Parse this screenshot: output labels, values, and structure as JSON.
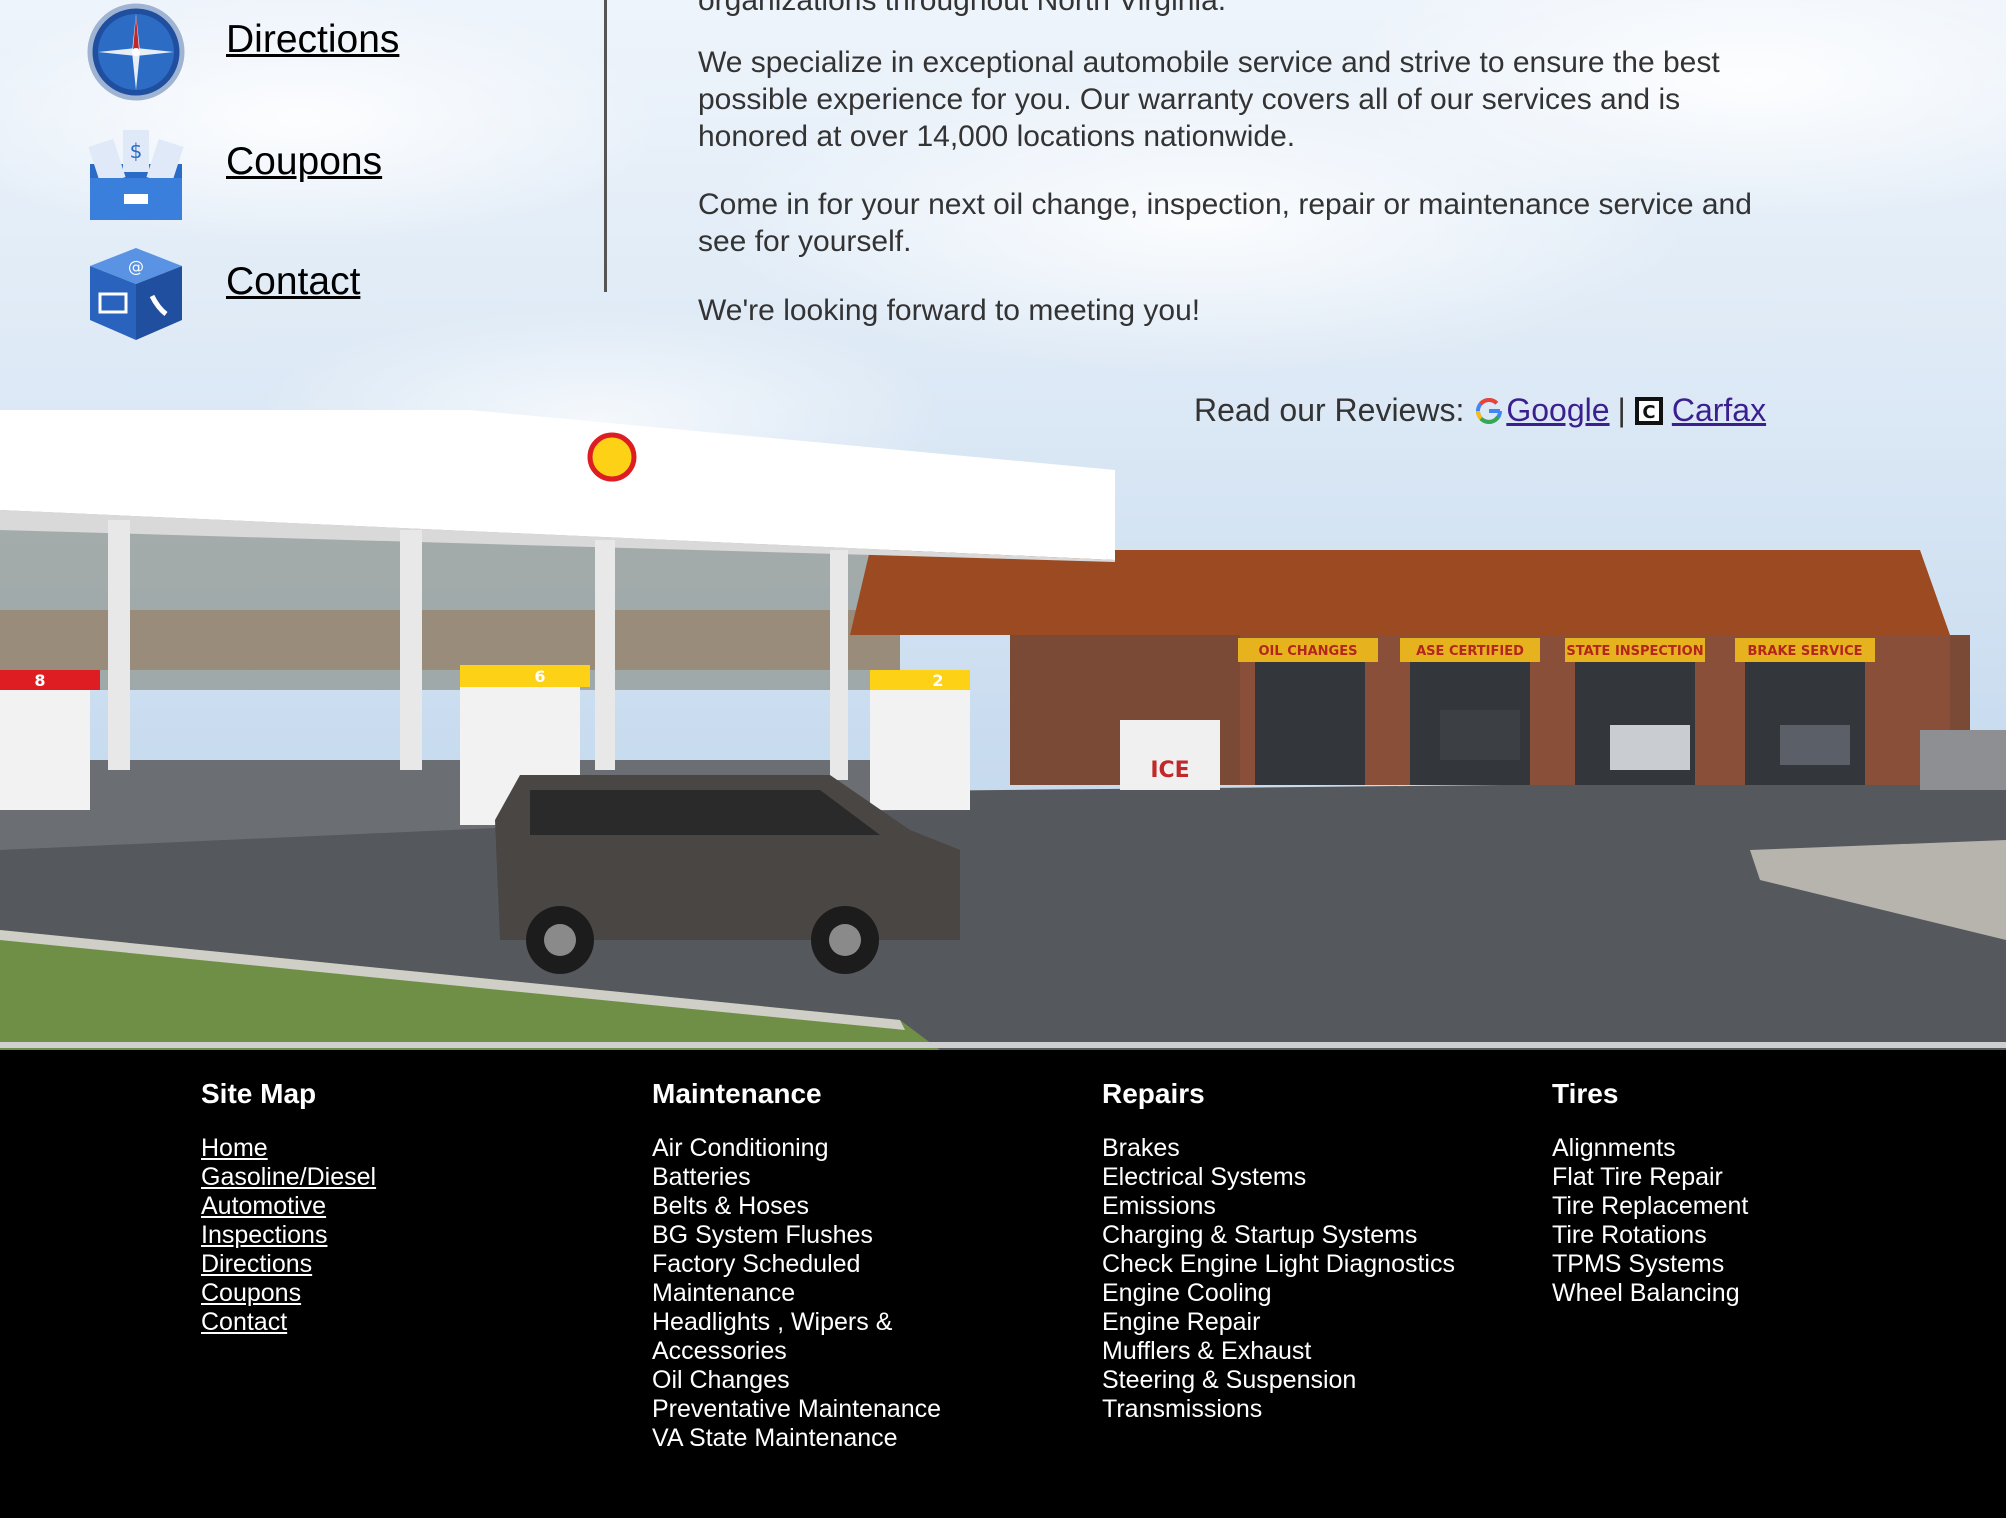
{
  "nav": {
    "directions": {
      "label": "Directions",
      "icon": "compass-icon"
    },
    "coupons": {
      "label": "Coupons",
      "icon": "coupons-icon"
    },
    "contact": {
      "label": "Contact",
      "icon": "contact-cube-icon"
    }
  },
  "intro": {
    "p0": "organizations throughout North Virginia.",
    "p1": "We specialize in exceptional automobile service and strive to ensure the best possible experience for you. Our warranty covers all of our services and is honored at over 14,000 locations nationwide.",
    "p2": "Come in for your next oil change, inspection, repair or maintenance service and see for yourself.",
    "p3": "We're looking forward to meeting you!"
  },
  "reviews": {
    "prefix": "Read our Reviews:",
    "google": "Google",
    "separator": "|",
    "carfax": "Carfax"
  },
  "photo": {
    "bays": [
      "OIL CHANGES",
      "ASE CERTIFIED",
      "STATE INSPECTION",
      "BRAKE SERVICE"
    ],
    "ice": "ICE",
    "pumps": [
      "8",
      "6",
      "2"
    ]
  },
  "footer": {
    "sitemap": {
      "title": "Site Map",
      "items": [
        "Home",
        "Gasoline/Diesel",
        "Automotive",
        "Inspections",
        "Directions",
        "Coupons",
        "Contact"
      ]
    },
    "maintenance": {
      "title": "Maintenance",
      "items": [
        "Air Conditioning",
        "Batteries",
        "Belts & Hoses",
        "BG System Flushes",
        "Factory Scheduled",
        "Maintenance",
        "Headlights , Wipers &",
        "Accessories",
        "Oil Changes",
        "Preventative Maintenance",
        "VA State Maintenance"
      ]
    },
    "repairs": {
      "title": "Repairs",
      "items": [
        "Brakes",
        "Electrical Systems",
        "Emissions",
        "Charging & Startup Systems",
        "Check Engine Light Diagnostics",
        "Engine Cooling",
        "Engine Repair",
        "Mufflers & Exhaust",
        "Steering & Suspension",
        "Transmissions"
      ]
    },
    "tires": {
      "title": "Tires",
      "items": [
        "Alignments",
        "Flat Tire Repair",
        "Tire Replacement",
        "Tire Rotations",
        "TPMS Systems",
        "Wheel Balancing"
      ]
    }
  },
  "colors": {
    "link": "#3b1f8f",
    "footer_bg": "#000000",
    "text": "#333333"
  }
}
